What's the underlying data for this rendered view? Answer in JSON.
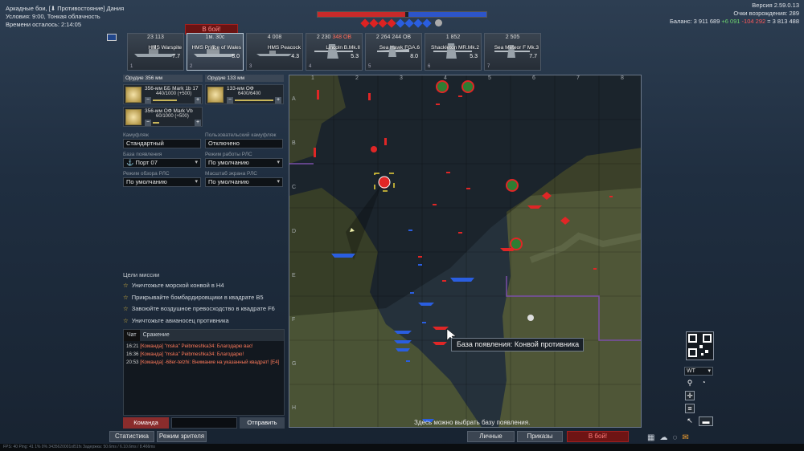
{
  "top_left": {
    "mode": "Аркадные бои, [⬇ Противостояние] Дания",
    "conditions": "Условия: 9:00, Тонкая облачность",
    "time_left": "Времени осталось: 2:14:05"
  },
  "top_right": {
    "version": "Версия 2.59.0.13",
    "respawn_points": "Очки возрождения: 289",
    "balance_label": "Баланс:",
    "balance_main": "3 911 689",
    "balance_plus": "+6 091",
    "balance_minus": "-104 292",
    "balance_total": "= 3 813 488"
  },
  "to_battle_top": "В бой!",
  "vehicles": [
    {
      "cost": "23 113",
      "over": "",
      "name": "HMS Warspite",
      "br": "7.7",
      "idx": "1"
    },
    {
      "cost": "1м. 30с",
      "over": "",
      "name": "HMS Prince of Wales",
      "br": "8.0",
      "idx": "2"
    },
    {
      "cost": "4 008",
      "over": "",
      "name": "HMS Peacock",
      "br": "4.3",
      "idx": "3"
    },
    {
      "cost": "2 230",
      "over": "348 ОВ",
      "name": "Lincoln B.Mk.II",
      "br": "5.3",
      "idx": "4"
    },
    {
      "cost": "2 264",
      "over": "244 ОВ",
      "name": "Sea Hawk FGA.6",
      "br": "8.0",
      "idx": "5"
    },
    {
      "cost": "1 852",
      "over": "",
      "name": "Shackleton MR.Mk.2",
      "br": "5.3",
      "idx": "6"
    },
    {
      "cost": "2 505",
      "over": "",
      "name": "Sea Meteor F Mk.3",
      "br": "7.7",
      "idx": "7"
    }
  ],
  "weapons": {
    "tab1": "Орудие 356 мм",
    "tab2": "Орудие 133 мм",
    "w1_name": "356-мм ББ Mark 1b 17",
    "w1_ammo": "440/1000 (+500)",
    "w2_name": "133-мм ОФ",
    "w2_ammo": "6400/6400",
    "w3_name": "356-мм ОФ Mark Vb",
    "w3_ammo": "60/1000 (+500)"
  },
  "settings": {
    "camo_label": "Камуфляж",
    "camo_value": "Стандартный",
    "usercamo_label": "Пользовательский камуфляж",
    "usercamo_value": "Отключено",
    "base_label": "База появления",
    "base_value": "Порт 07",
    "radar_mode_label": "Режим работы РЛС",
    "radar_mode_value": "По умолчанию",
    "radar_view_label": "Режим обзора РЛС",
    "radar_view_value": "По умолчанию",
    "radar_scale_label": "Масштаб экрана РЛС",
    "radar_scale_value": "По умолчанию"
  },
  "mission": {
    "header": "Цели миссии",
    "items": [
      "Уничтожьте морской конвой в  H4",
      "Прикрывайте бомбардировщики в квадрате  B5",
      "Завоюйте воздушное превосходство в квадрате  F6",
      "Уничтожьте авианосец противника"
    ]
  },
  "chat": {
    "tab_chat": "Чат",
    "tab_battle": "Сражение",
    "lines": [
      {
        "time": "16:21",
        "text": "[Команда] \"mska\" Peibmeshka34: Благодарю вас!"
      },
      {
        "time": "16:36",
        "text": "[Команда] \"mska\" Peibmeshka34: Благодарю!"
      },
      {
        "time": "20:53",
        "text": "[Команда] -68er-telzhi: Внимание на указанный квадрат! [E4]"
      }
    ],
    "team_button": "Команда",
    "send_button": "Отправить"
  },
  "map": {
    "cols": [
      "1",
      "2",
      "3",
      "4",
      "5",
      "6",
      "7",
      "8"
    ],
    "rows": [
      "A",
      "B",
      "C",
      "D",
      "E",
      "F",
      "G",
      "H"
    ],
    "tooltip": "База появления: Конвой противника",
    "hint": "Здесь можно выбрать базу появления.",
    "layer_select": "WT"
  },
  "bottom": {
    "stats": "Статистика",
    "spectator": "Режим зрителя",
    "tasks": "Личные задания",
    "orders": "Приказы",
    "to_battle": "В бой!",
    "status": "FPS: 40   Ping: 41   1%   0%   3435620001ol51fs   Задержка: 50.6ms / 6.10.6ms / 8.466ms"
  },
  "colors": {
    "ally": "#2a5ee0",
    "enemy": "#e02626",
    "accent": "#c8b55a"
  }
}
